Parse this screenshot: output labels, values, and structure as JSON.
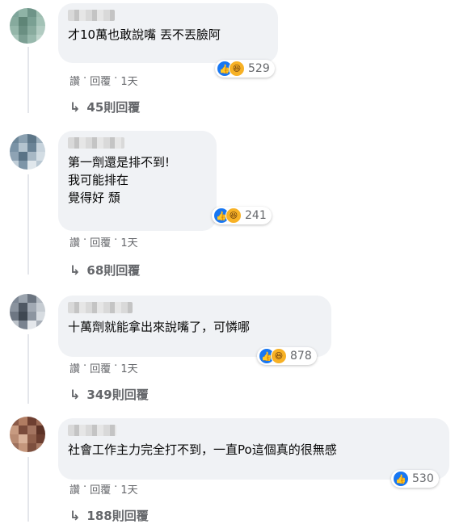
{
  "comments": [
    {
      "text": "才10萬也敢說嘴 丟不丟臉阿",
      "reaction_count": "529",
      "reactions": [
        "like-icon",
        "haha-icon"
      ],
      "actions": {
        "like": "讚",
        "dot1": "·",
        "reply": "回覆",
        "dot2": "·",
        "time": "1天"
      },
      "replies": "45則回覆"
    },
    {
      "text": "第一劑還是排不到!\n我可能排在\n覺得好 頹",
      "reaction_count": "241",
      "reactions": [
        "like-icon",
        "haha-icon"
      ],
      "actions": {
        "like": "讚",
        "dot1": "·",
        "reply": "回覆",
        "dot2": "·",
        "time": "1天"
      },
      "replies": "68則回覆"
    },
    {
      "text": "十萬劑就能拿出來說嘴了，可憐哪",
      "reaction_count": "878",
      "reactions": [
        "like-icon",
        "haha-icon"
      ],
      "actions": {
        "like": "讚",
        "dot1": "·",
        "reply": "回覆",
        "dot2": "·",
        "time": "1天"
      },
      "replies": "349則回覆"
    },
    {
      "text": "社會工作主力完全打不到，一直Po這個真的很無感",
      "reaction_count": "530",
      "reactions": [
        "like-icon"
      ],
      "actions": {
        "like": "讚",
        "dot1": "·",
        "reply": "回覆",
        "dot2": "·",
        "time": "1天"
      },
      "replies": "188則回覆"
    }
  ],
  "colors": {
    "bubble": "#f0f2f5",
    "like": "#1877f2",
    "haha": "#f7b125",
    "meta": "#65676b"
  }
}
